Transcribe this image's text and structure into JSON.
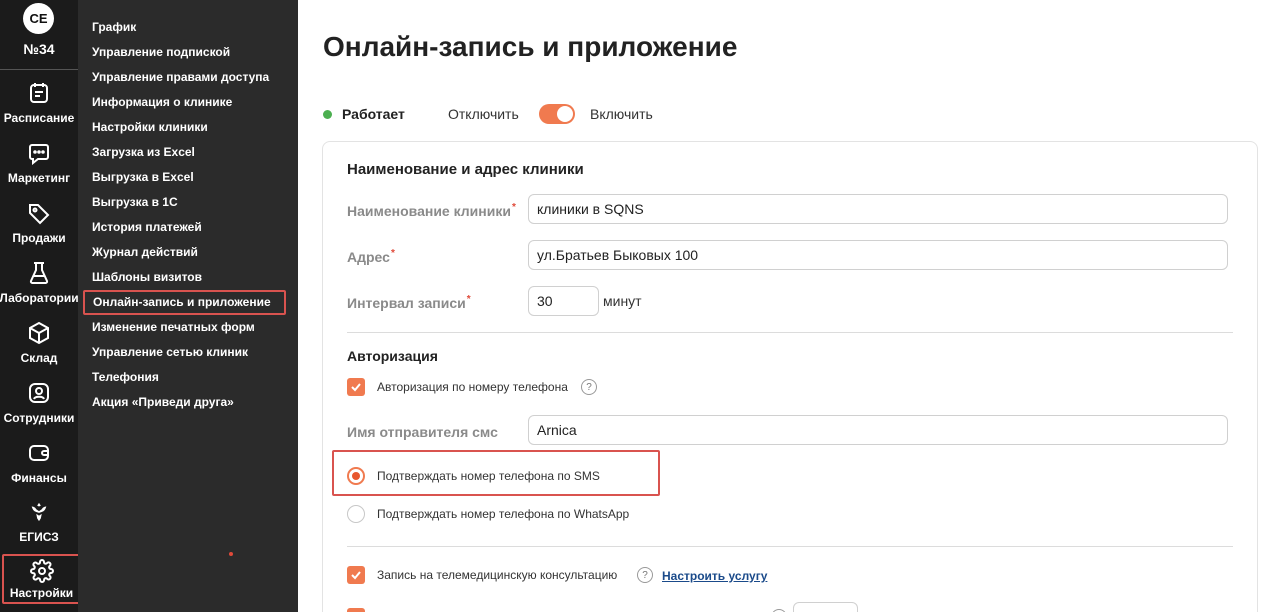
{
  "rail": {
    "avatar": "СЕ",
    "clinic_number": "№34",
    "items": [
      {
        "label": "Расписание",
        "icon": "calendar-icon"
      },
      {
        "label": "Маркетинг",
        "icon": "chat-icon"
      },
      {
        "label": "Продажи",
        "icon": "tag-icon"
      },
      {
        "label": "Лаборатории",
        "icon": "flask-icon"
      },
      {
        "label": "Склад",
        "icon": "box-icon"
      },
      {
        "label": "Сотрудники",
        "icon": "user-icon"
      },
      {
        "label": "Финансы",
        "icon": "wallet-icon"
      },
      {
        "label": "ЕГИСЗ",
        "icon": "emblem-icon"
      },
      {
        "label": "Настройки",
        "icon": "gear-icon"
      }
    ]
  },
  "submenu": {
    "items": [
      "График",
      "Управление подпиской",
      "Управление правами доступа",
      "Информация о клинике",
      "Настройки клиники",
      "Загрузка из Excel",
      "Выгрузка в Excel",
      "Выгрузка в 1С",
      "История платежей",
      "Журнал действий",
      "Шаблоны визитов",
      "Онлайн-запись и приложение",
      "Изменение печатных форм",
      "Управление сетью клиник",
      "Телефония",
      "Акция «Приведи друга»"
    ],
    "active_index": 11
  },
  "main": {
    "title": "Онлайн-запись и приложение",
    "status": "Работает",
    "toggle_off": "Отключить",
    "toggle_on": "Включить",
    "toggle_state": "on",
    "accent_color": "#f07a4f",
    "section_name_address": "Наименование и адрес клиники",
    "clinic_name_label": "Наименование клиники",
    "clinic_name_value": "клиники в SQNS",
    "address_label": "Адрес",
    "address_value": "ул.Братьев Быковых 100",
    "interval_label": "Интервал записи",
    "interval_value": "30",
    "interval_unit": "минут",
    "required_mark": "*",
    "section_auth": "Авторизация",
    "auth_by_phone": "Авторизация по номеру телефона",
    "help_mark": "?",
    "sms_sender_label": "Имя отправителя смс",
    "sms_sender_value": "Arnica",
    "confirm_sms": "Подтверждать номер телефона по SMS",
    "confirm_whatsapp": "Подтверждать номер телефона по WhatsApp",
    "telemed": "Запись на телемедицинскую консультацию",
    "setup_service": "Настроить услугу"
  }
}
